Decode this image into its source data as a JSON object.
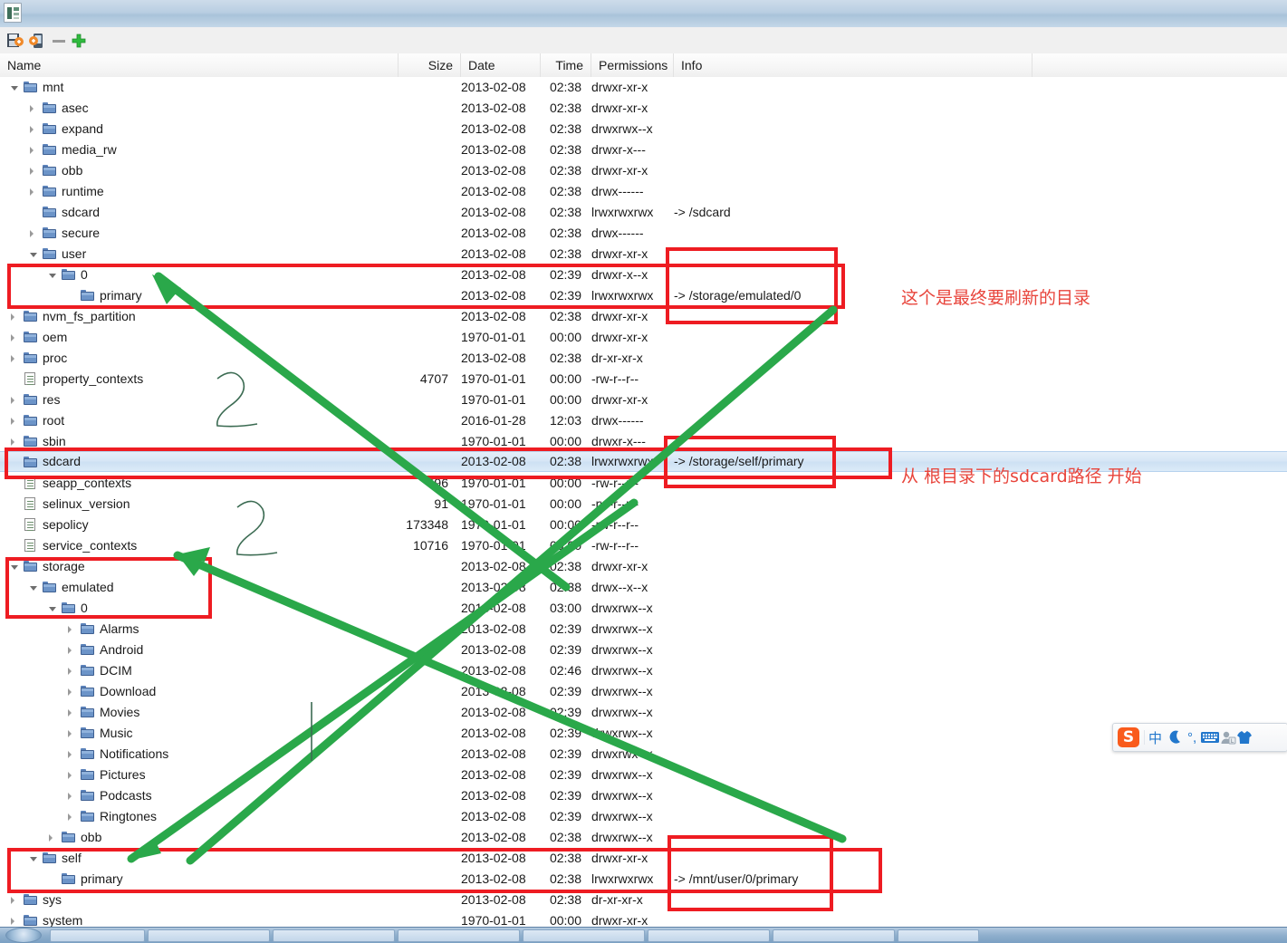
{
  "window": {
    "title": "",
    "app_icon": "device-explorer-icon"
  },
  "toolbar": {
    "buttons": [
      {
        "name": "save-to-pc-icon",
        "label": ""
      },
      {
        "name": "push-to-device-icon",
        "label": ""
      },
      {
        "name": "delete-minus-icon",
        "label": ""
      },
      {
        "name": "add-plus-icon",
        "label": ""
      }
    ]
  },
  "columns": [
    {
      "key": "name",
      "label": "Name"
    },
    {
      "key": "size",
      "label": "Size"
    },
    {
      "key": "date",
      "label": "Date"
    },
    {
      "key": "time",
      "label": "Time"
    },
    {
      "key": "permissions",
      "label": "Permissions"
    },
    {
      "key": "info",
      "label": "Info"
    }
  ],
  "rows": [
    {
      "name": "mnt",
      "indent": 0,
      "icon": "folder",
      "twisty": "open",
      "size": "",
      "date": "2013-02-08",
      "time": "02:38",
      "perm": "drwxr-xr-x",
      "info": "",
      "selected": false
    },
    {
      "name": "asec",
      "indent": 1,
      "icon": "folder",
      "twisty": "closed",
      "size": "",
      "date": "2013-02-08",
      "time": "02:38",
      "perm": "drwxr-xr-x",
      "info": "",
      "selected": false
    },
    {
      "name": "expand",
      "indent": 1,
      "icon": "folder",
      "twisty": "closed",
      "size": "",
      "date": "2013-02-08",
      "time": "02:38",
      "perm": "drwxrwx--x",
      "info": "",
      "selected": false
    },
    {
      "name": "media_rw",
      "indent": 1,
      "icon": "folder",
      "twisty": "closed",
      "size": "",
      "date": "2013-02-08",
      "time": "02:38",
      "perm": "drwxr-x---",
      "info": "",
      "selected": false
    },
    {
      "name": "obb",
      "indent": 1,
      "icon": "folder",
      "twisty": "closed",
      "size": "",
      "date": "2013-02-08",
      "time": "02:38",
      "perm": "drwxr-xr-x",
      "info": "",
      "selected": false
    },
    {
      "name": "runtime",
      "indent": 1,
      "icon": "folder",
      "twisty": "closed",
      "size": "",
      "date": "2013-02-08",
      "time": "02:38",
      "perm": "drwx------",
      "info": "",
      "selected": false
    },
    {
      "name": "sdcard",
      "indent": 1,
      "icon": "folder",
      "twisty": "none",
      "size": "",
      "date": "2013-02-08",
      "time": "02:38",
      "perm": "lrwxrwxrwx",
      "info": "-> /sdcard",
      "selected": false
    },
    {
      "name": "secure",
      "indent": 1,
      "icon": "folder",
      "twisty": "closed",
      "size": "",
      "date": "2013-02-08",
      "time": "02:38",
      "perm": "drwx------",
      "info": "",
      "selected": false
    },
    {
      "name": "user",
      "indent": 1,
      "icon": "folder",
      "twisty": "open",
      "size": "",
      "date": "2013-02-08",
      "time": "02:38",
      "perm": "drwxr-xr-x",
      "info": "",
      "selected": false
    },
    {
      "name": "0",
      "indent": 2,
      "icon": "folder",
      "twisty": "open",
      "size": "",
      "date": "2013-02-08",
      "time": "02:39",
      "perm": "drwxr-x--x",
      "info": "",
      "selected": false
    },
    {
      "name": "primary",
      "indent": 3,
      "icon": "folder",
      "twisty": "none",
      "size": "",
      "date": "2013-02-08",
      "time": "02:39",
      "perm": "lrwxrwxrwx",
      "info": "-> /storage/emulated/0",
      "selected": false
    },
    {
      "name": "nvm_fs_partition",
      "indent": 0,
      "icon": "folder",
      "twisty": "closed",
      "size": "",
      "date": "2013-02-08",
      "time": "02:38",
      "perm": "drwxr-xr-x",
      "info": "",
      "selected": false
    },
    {
      "name": "oem",
      "indent": 0,
      "icon": "folder",
      "twisty": "closed",
      "size": "",
      "date": "1970-01-01",
      "time": "00:00",
      "perm": "drwxr-xr-x",
      "info": "",
      "selected": false
    },
    {
      "name": "proc",
      "indent": 0,
      "icon": "folder",
      "twisty": "closed",
      "size": "",
      "date": "2013-02-08",
      "time": "02:38",
      "perm": "dr-xr-xr-x",
      "info": "",
      "selected": false
    },
    {
      "name": "property_contexts",
      "indent": 0,
      "icon": "doc",
      "twisty": "none",
      "size": "4707",
      "date": "1970-01-01",
      "time": "00:00",
      "perm": "-rw-r--r--",
      "info": "",
      "selected": false
    },
    {
      "name": "res",
      "indent": 0,
      "icon": "folder",
      "twisty": "closed",
      "size": "",
      "date": "1970-01-01",
      "time": "00:00",
      "perm": "drwxr-xr-x",
      "info": "",
      "selected": false
    },
    {
      "name": "root",
      "indent": 0,
      "icon": "folder",
      "twisty": "closed",
      "size": "",
      "date": "2016-01-28",
      "time": "12:03",
      "perm": "drwx------",
      "info": "",
      "selected": false
    },
    {
      "name": "sbin",
      "indent": 0,
      "icon": "folder",
      "twisty": "closed",
      "size": "",
      "date": "1970-01-01",
      "time": "00:00",
      "perm": "drwxr-x---",
      "info": "",
      "selected": false
    },
    {
      "name": "sdcard",
      "indent": 0,
      "icon": "folder",
      "twisty": "none",
      "size": "",
      "date": "2013-02-08",
      "time": "02:38",
      "perm": "lrwxrwxrwx",
      "info": "-> /storage/self/primary",
      "selected": true
    },
    {
      "name": "seapp_contexts",
      "indent": 0,
      "icon": "doc",
      "twisty": "none",
      "size": "596",
      "date": "1970-01-01",
      "time": "00:00",
      "perm": "-rw-r--r--",
      "info": "",
      "selected": false
    },
    {
      "name": "selinux_version",
      "indent": 0,
      "icon": "doc",
      "twisty": "none",
      "size": "91",
      "date": "1970-01-01",
      "time": "00:00",
      "perm": "-rw-r--r--",
      "info": "",
      "selected": false
    },
    {
      "name": "sepolicy",
      "indent": 0,
      "icon": "doc",
      "twisty": "none",
      "size": "173348",
      "date": "1970-01-01",
      "time": "00:00",
      "perm": "-rw-r--r--",
      "info": "",
      "selected": false
    },
    {
      "name": "service_contexts",
      "indent": 0,
      "icon": "doc",
      "twisty": "none",
      "size": "10716",
      "date": "1970-01-01",
      "time": "00:00",
      "perm": "-rw-r--r--",
      "info": "",
      "selected": false
    },
    {
      "name": "storage",
      "indent": 0,
      "icon": "folder",
      "twisty": "open",
      "size": "",
      "date": "2013-02-08",
      "time": "02:38",
      "perm": "drwxr-xr-x",
      "info": "",
      "selected": false
    },
    {
      "name": "emulated",
      "indent": 1,
      "icon": "folder",
      "twisty": "open",
      "size": "",
      "date": "2013-02-08",
      "time": "02:38",
      "perm": "drwx--x--x",
      "info": "",
      "selected": false
    },
    {
      "name": "0",
      "indent": 2,
      "icon": "folder",
      "twisty": "open",
      "size": "",
      "date": "2013-02-08",
      "time": "03:00",
      "perm": "drwxrwx--x",
      "info": "",
      "selected": false
    },
    {
      "name": "Alarms",
      "indent": 3,
      "icon": "folder",
      "twisty": "closed",
      "size": "",
      "date": "2013-02-08",
      "time": "02:39",
      "perm": "drwxrwx--x",
      "info": "",
      "selected": false
    },
    {
      "name": "Android",
      "indent": 3,
      "icon": "folder",
      "twisty": "closed",
      "size": "",
      "date": "2013-02-08",
      "time": "02:39",
      "perm": "drwxrwx--x",
      "info": "",
      "selected": false
    },
    {
      "name": "DCIM",
      "indent": 3,
      "icon": "folder",
      "twisty": "closed",
      "size": "",
      "date": "2013-02-08",
      "time": "02:46",
      "perm": "drwxrwx--x",
      "info": "",
      "selected": false
    },
    {
      "name": "Download",
      "indent": 3,
      "icon": "folder",
      "twisty": "closed",
      "size": "",
      "date": "2013-02-08",
      "time": "02:39",
      "perm": "drwxrwx--x",
      "info": "",
      "selected": false
    },
    {
      "name": "Movies",
      "indent": 3,
      "icon": "folder",
      "twisty": "closed",
      "size": "",
      "date": "2013-02-08",
      "time": "02:39",
      "perm": "drwxrwx--x",
      "info": "",
      "selected": false
    },
    {
      "name": "Music",
      "indent": 3,
      "icon": "folder",
      "twisty": "closed",
      "size": "",
      "date": "2013-02-08",
      "time": "02:39",
      "perm": "drwxrwx--x",
      "info": "",
      "selected": false
    },
    {
      "name": "Notifications",
      "indent": 3,
      "icon": "folder",
      "twisty": "closed",
      "size": "",
      "date": "2013-02-08",
      "time": "02:39",
      "perm": "drwxrwx--x",
      "info": "",
      "selected": false
    },
    {
      "name": "Pictures",
      "indent": 3,
      "icon": "folder",
      "twisty": "closed",
      "size": "",
      "date": "2013-02-08",
      "time": "02:39",
      "perm": "drwxrwx--x",
      "info": "",
      "selected": false
    },
    {
      "name": "Podcasts",
      "indent": 3,
      "icon": "folder",
      "twisty": "closed",
      "size": "",
      "date": "2013-02-08",
      "time": "02:39",
      "perm": "drwxrwx--x",
      "info": "",
      "selected": false
    },
    {
      "name": "Ringtones",
      "indent": 3,
      "icon": "folder",
      "twisty": "closed",
      "size": "",
      "date": "2013-02-08",
      "time": "02:39",
      "perm": "drwxrwx--x",
      "info": "",
      "selected": false
    },
    {
      "name": "obb",
      "indent": 2,
      "icon": "folder",
      "twisty": "closed",
      "size": "",
      "date": "2013-02-08",
      "time": "02:38",
      "perm": "drwxrwx--x",
      "info": "",
      "selected": false
    },
    {
      "name": "self",
      "indent": 1,
      "icon": "folder",
      "twisty": "open",
      "size": "",
      "date": "2013-02-08",
      "time": "02:38",
      "perm": "drwxr-xr-x",
      "info": "",
      "selected": false
    },
    {
      "name": "primary",
      "indent": 2,
      "icon": "folder",
      "twisty": "none",
      "size": "",
      "date": "2013-02-08",
      "time": "02:38",
      "perm": "lrwxrwxrwx",
      "info": "-> /mnt/user/0/primary",
      "selected": false
    },
    {
      "name": "sys",
      "indent": 0,
      "icon": "folder",
      "twisty": "closed",
      "size": "",
      "date": "2013-02-08",
      "time": "02:38",
      "perm": "dr-xr-xr-x",
      "info": "",
      "selected": false
    },
    {
      "name": "system",
      "indent": 0,
      "icon": "folder",
      "twisty": "closed",
      "size": "",
      "date": "1970-01-01",
      "time": "00:00",
      "perm": "drwxr-xr-x",
      "info": "",
      "selected": false
    }
  ],
  "annotations": {
    "color_box": "#ee1c22",
    "color_text": "#e8453c",
    "color_arrow": "#2aa84a",
    "notes": [
      {
        "id": "note-target-dir",
        "text": "这个是最终要刷新的目录"
      },
      {
        "id": "note-start-from",
        "text": "从  根目录下的sdcard路径 开始"
      }
    ]
  },
  "ime": {
    "name": "sogou-input-method",
    "logo": "S",
    "items": [
      {
        "name": "chinese-mode-icon",
        "glyph": "中"
      },
      {
        "name": "moon-icon",
        "glyph": "🌙"
      },
      {
        "name": "punctuation-icon",
        "glyph": "°,"
      },
      {
        "name": "keyboard-icon",
        "glyph": "⌨"
      },
      {
        "name": "user-icon",
        "glyph": "👤"
      },
      {
        "name": "skin-icon",
        "glyph": "👕"
      }
    ]
  }
}
